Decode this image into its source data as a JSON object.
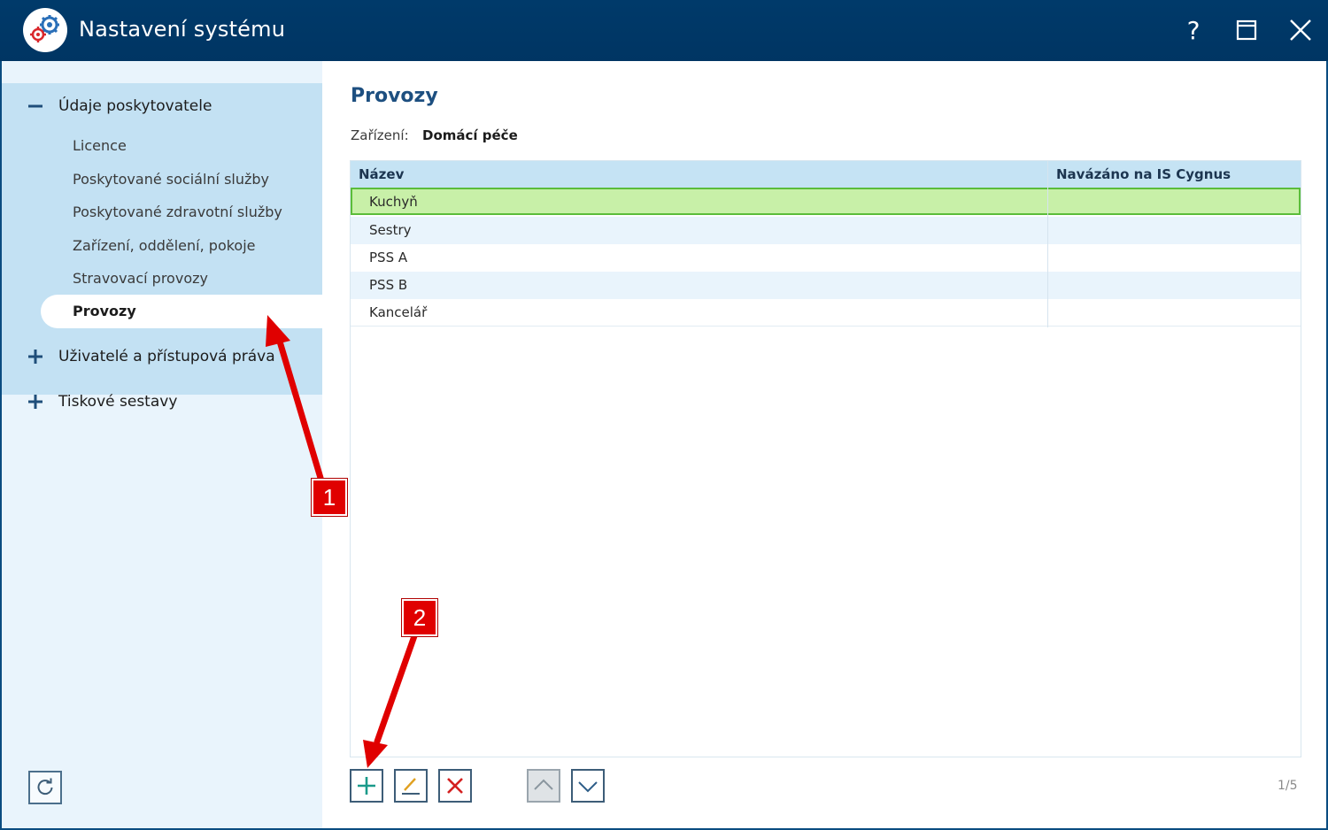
{
  "window": {
    "title": "Nastavení systému",
    "help_glyph": "?",
    "accent_color": "#003a6a"
  },
  "sidebar": {
    "groups": [
      {
        "label": "Údaje poskytovatele",
        "state": "expanded",
        "items": [
          {
            "label": "Licence"
          },
          {
            "label": "Poskytované sociální služby"
          },
          {
            "label": "Poskytované zdravotní služby"
          },
          {
            "label": "Zařízení, oddělení, pokoje"
          },
          {
            "label": "Stravovací provozy"
          },
          {
            "label": "Provozy",
            "active": true
          }
        ]
      },
      {
        "label": "Uživatelé a přístupová práva",
        "state": "collapsed"
      },
      {
        "label": "Tiskové sestavy",
        "state": "collapsed"
      }
    ],
    "refresh_icon": "refresh-icon"
  },
  "main": {
    "title": "Provozy",
    "facility_label": "Zařízení:",
    "facility_value": "Domácí péče",
    "table": {
      "columns": [
        "Název",
        "Navázáno na IS Cygnus"
      ],
      "rows": [
        {
          "name": "Kuchyň",
          "linked": "",
          "selected": true
        },
        {
          "name": "Sestry",
          "linked": ""
        },
        {
          "name": "PSS A",
          "linked": ""
        },
        {
          "name": "PSS B",
          "linked": ""
        },
        {
          "name": "Kancelář",
          "linked": ""
        }
      ]
    },
    "actions": {
      "add_icon": "plus-icon",
      "edit_icon": "pencil-icon",
      "delete_icon": "x-icon",
      "up_icon": "chevron-up-icon",
      "down_icon": "chevron-down-icon"
    },
    "pager": "1/5"
  },
  "annotations": [
    {
      "label": "1"
    },
    {
      "label": "2"
    }
  ],
  "colors": {
    "selected_row": "#c8f0a8",
    "selected_border": "#5bbd3a",
    "annotation": "#e00000",
    "sidebar_bg": "#e9f4fc",
    "sidebar_group_bg": "#c3e1f3"
  }
}
